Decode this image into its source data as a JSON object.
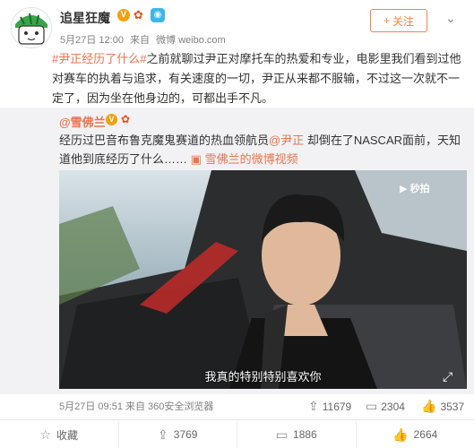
{
  "post": {
    "username": "追星狂魔",
    "timestamp": "5月27日 12:00",
    "source_prefix": "来自",
    "source": "微博 weibo.com",
    "follow_label": "关注",
    "text_tag": "#尹正经历了什么#",
    "text_body": "之前就聊过尹正对摩托车的热爱和专业，电影里我们看到过他对赛车的执着与追求，有关速度的一切，尹正从来都不服输，不过这一次就不一定了，因为坐在他身边的，可都出手不凡。"
  },
  "repost": {
    "username": "@雪佛兰",
    "text_start": "经历过巴音布鲁克魔鬼赛道的热血领航员",
    "mention": "@尹正",
    "text_end": " 却倒在了NASCAR面前，天知道他到底经历了什么……",
    "video_link": "雪佛兰的微博视频",
    "video_logo": "秒拍",
    "subtitle": "我真的特别特别喜欢你",
    "meta_time": "5月27日 09:51",
    "meta_source": "来自 360安全浏览器",
    "stats": {
      "share": "11679",
      "comment": "2304",
      "like": "3537"
    }
  },
  "actions": {
    "favorite": "收藏",
    "share": "3769",
    "comment": "1886",
    "like": "2664"
  },
  "colors": {
    "accent": "#eb7350",
    "follow": "#ff8140",
    "repost_bg": "#f2f2f5"
  }
}
